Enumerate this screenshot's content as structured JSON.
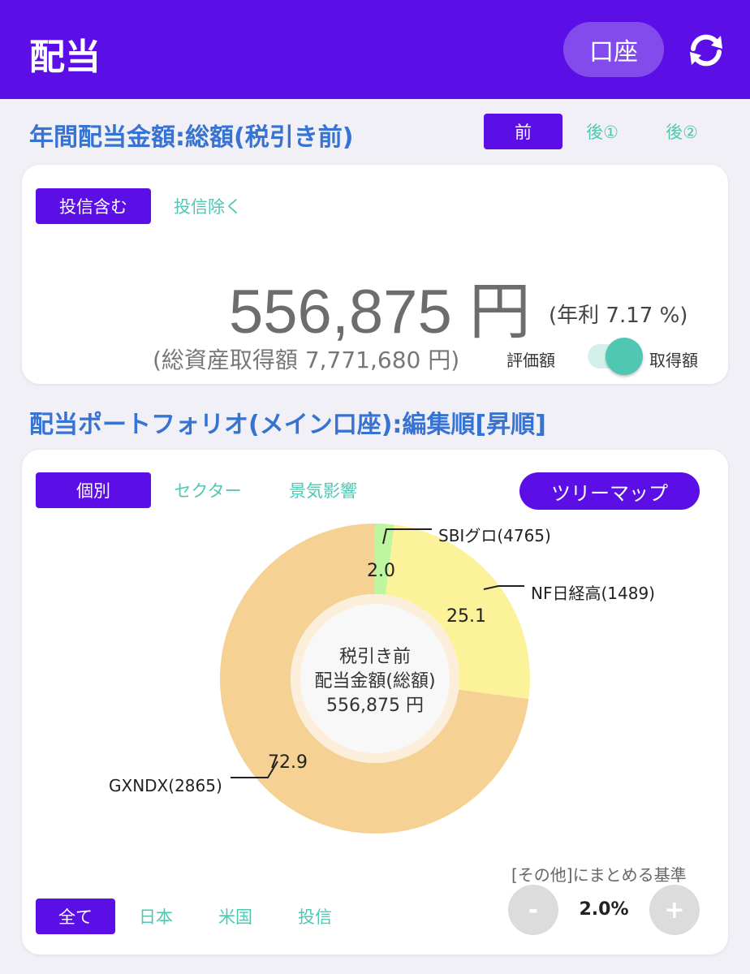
{
  "header": {
    "title": "配当",
    "account_label": "口座",
    "sync_icon": "sync-icon"
  },
  "annual": {
    "title": "年間配当金額:総額(税引き前)",
    "tax_tabs": [
      {
        "label": "前",
        "active": true
      },
      {
        "label": "後①",
        "active": false
      },
      {
        "label": "後②",
        "active": false
      }
    ],
    "fund_tabs": [
      {
        "label": "投信含む",
        "active": true
      },
      {
        "label": "投信除く",
        "active": false
      }
    ],
    "amount": "556,875 円",
    "yield_text": "(年利 7.17 %)",
    "total_assets": "(総資産取得額 7,771,680 円)",
    "toggle": {
      "left_label": "評価額",
      "right_label": "取得額",
      "selected": "取得額"
    }
  },
  "portfolio": {
    "title": "配当ポートフォリオ(メイン口座):編集順[昇順]",
    "view_tabs": [
      {
        "label": "個別",
        "active": true
      },
      {
        "label": "セクター",
        "active": false
      },
      {
        "label": "景気影響",
        "active": false
      }
    ],
    "treemap_label": "ツリーマップ",
    "center": {
      "line1": "税引き前",
      "line2": "配当金額(総額)",
      "line3": "556,875 円"
    },
    "region_tabs": [
      {
        "label": "全て",
        "active": true
      },
      {
        "label": "日本",
        "active": false
      },
      {
        "label": "米国",
        "active": false
      },
      {
        "label": "投信",
        "active": false
      }
    ],
    "threshold": {
      "label": "[その他]にまとめる基準",
      "value": "2.0%",
      "minus": "-",
      "plus": "+"
    }
  },
  "chart_data": {
    "type": "pie",
    "categories": [
      "SBIグロ(4765)",
      "NF日経高(1489)",
      "GXNDX(2865)"
    ],
    "values": [
      2.0,
      25.1,
      72.9
    ],
    "value_labels": [
      "2.0",
      "25.1",
      "72.9"
    ],
    "colors": [
      "#bdf5a0",
      "#fbf29a",
      "#f5d293"
    ]
  }
}
